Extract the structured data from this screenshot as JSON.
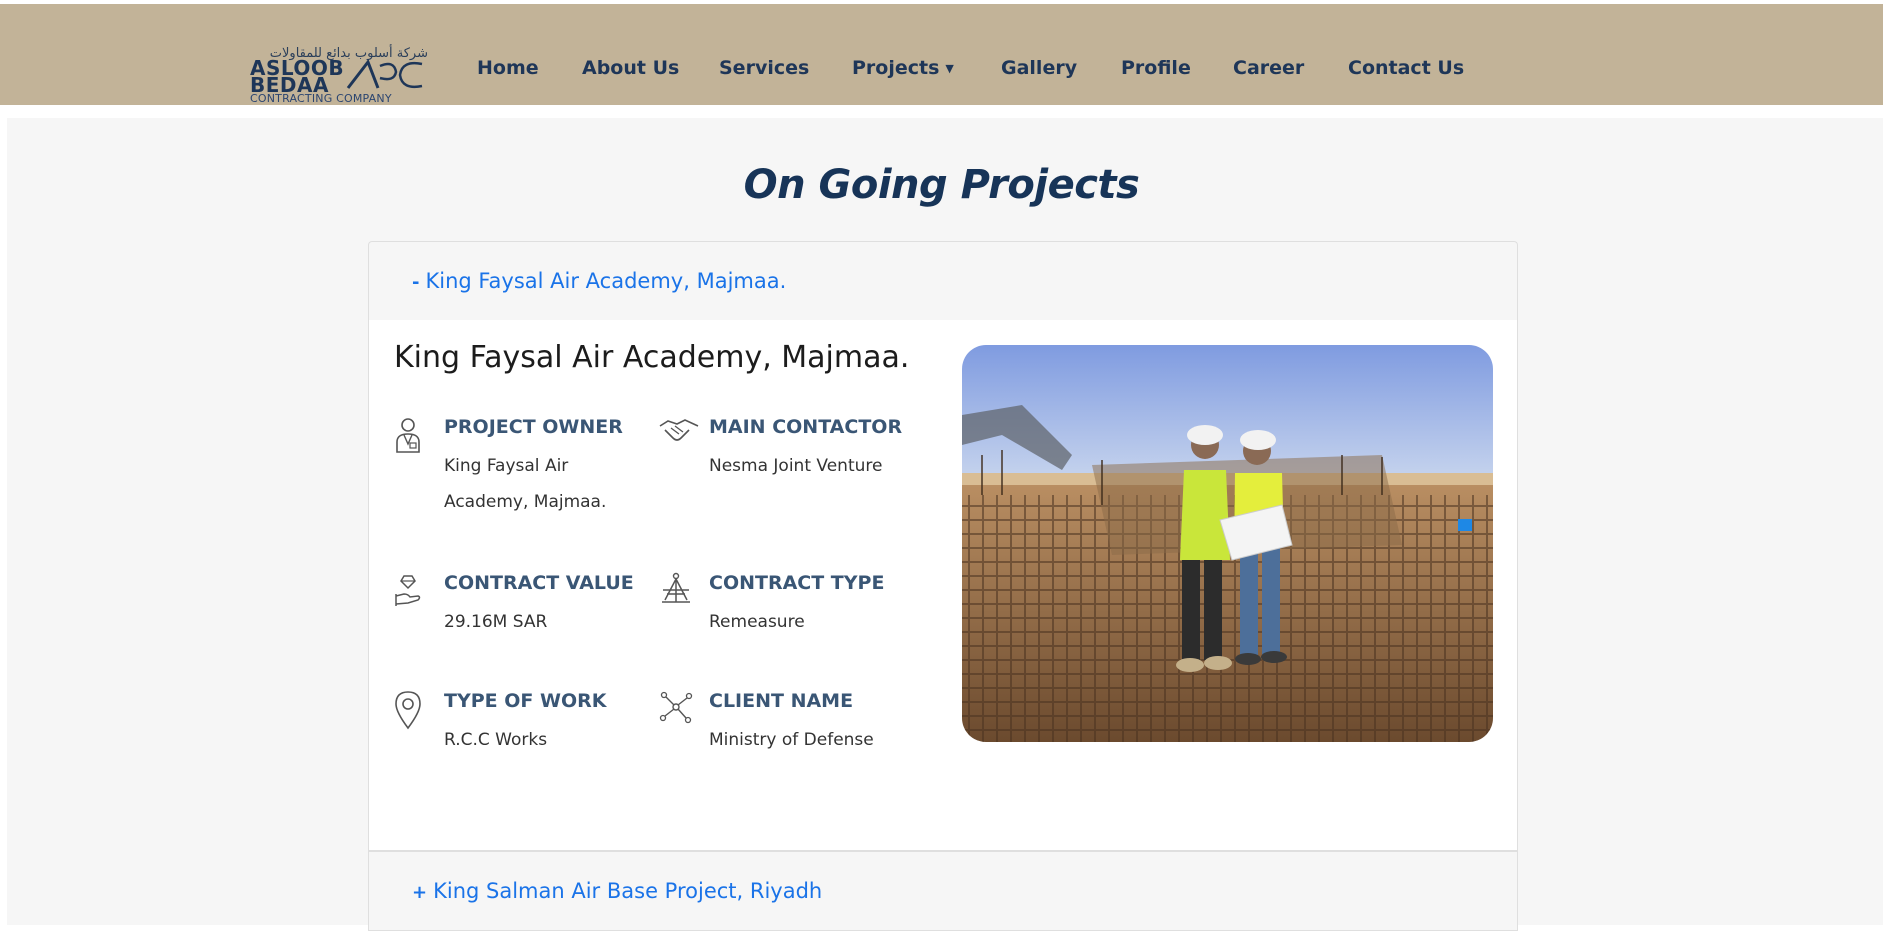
{
  "logo": {
    "arabic_text": "شركة أسلوب بدائع للمقاولات",
    "line1": "ASLOOB",
    "line2": "BEDAA",
    "line3": "CONTRACTING COMPANY"
  },
  "nav": {
    "items": [
      {
        "label": "Home"
      },
      {
        "label": "About Us"
      },
      {
        "label": "Services"
      },
      {
        "label": "Projects"
      },
      {
        "label": "Gallery"
      },
      {
        "label": "Profile"
      },
      {
        "label": "Career"
      },
      {
        "label": "Contact Us"
      }
    ]
  },
  "page": {
    "title": "On Going Projects"
  },
  "accordion": [
    {
      "sign": "-",
      "label": "King Faysal Air Academy, Majmaa.",
      "expanded": true
    },
    {
      "sign": "+",
      "label": "King Salman Air Base Project, Riyadh",
      "expanded": false
    }
  ],
  "project": {
    "title": "King Faysal Air Academy, Majmaa.",
    "fields": [
      {
        "icon": "person-icon",
        "label": "PROJECT OWNER",
        "value": "King Faysal Air Academy, Majmaa."
      },
      {
        "icon": "handshake-icon",
        "label": "MAIN CONTACTOR",
        "value": "Nesma Joint Venture"
      },
      {
        "icon": "money-hand-icon",
        "label": "CONTRACT VALUE",
        "value": "29.16M SAR"
      },
      {
        "icon": "structure-icon",
        "label": "CONTRACT TYPE",
        "value": "Remeasure"
      },
      {
        "icon": "location-pin-icon",
        "label": "TYPE OF WORK",
        "value": "R.C.C Works"
      },
      {
        "icon": "network-icon",
        "label": "CLIENT NAME",
        "value": "Ministry of Defense"
      }
    ]
  },
  "colors": {
    "header_bg": "#c2b398",
    "nav_text": "#1e3658",
    "title": "#173458",
    "accordion_link": "#1a73e8",
    "field_label": "#3a5675"
  }
}
